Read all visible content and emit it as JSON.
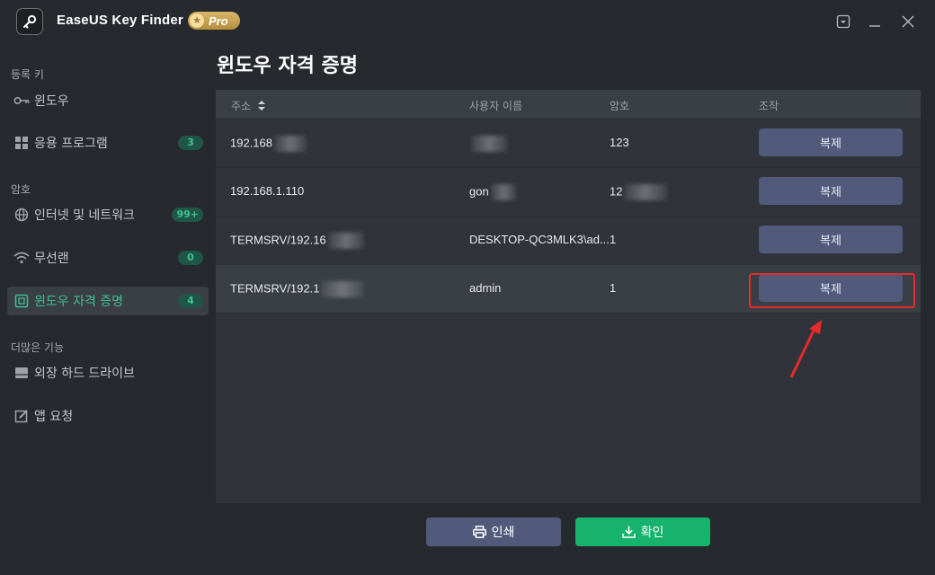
{
  "app": {
    "title": "EaseUS Key Finder",
    "pro_label": "Pro"
  },
  "sidebar": {
    "sections": [
      {
        "label": "등록 키"
      },
      {
        "label": "암호"
      },
      {
        "label": "더많은 기능"
      }
    ],
    "items": [
      {
        "label": "윈도우",
        "icon": "key-icon"
      },
      {
        "label": "응용 프로그램",
        "icon": "apps-grid-icon",
        "badge": "3"
      },
      {
        "label": "인터넷 및 네트워크",
        "icon": "globe-icon",
        "badge": "99+"
      },
      {
        "label": "무선랜",
        "icon": "wifi-icon",
        "badge": "0"
      },
      {
        "label": "윈도우 자격 증명",
        "icon": "credential-icon",
        "badge": "4",
        "active": true
      },
      {
        "label": "외장 하드 드라이브",
        "icon": "hard-drive-icon"
      },
      {
        "label": "앱 요청",
        "icon": "edit-icon"
      }
    ]
  },
  "main": {
    "title": "윈도우 자격 증명",
    "columns": [
      "주소",
      "사용자 이름",
      "암호",
      "조작"
    ],
    "rows": [
      {
        "address": "192.168",
        "username": "",
        "password": "123",
        "action": "복제"
      },
      {
        "address": "192.168.1.110",
        "username": "gon",
        "password": "12",
        "action": "복제"
      },
      {
        "address": "TERMSRV/192.16",
        "username": "DESKTOP-QC3MLK3\\ad...",
        "password": "1",
        "action": "복제"
      },
      {
        "address": "TERMSRV/192.1",
        "username": "admin",
        "password": "1",
        "action": "복제"
      }
    ]
  },
  "footer": {
    "print_label": "인쇄",
    "confirm_label": "확인"
  },
  "colors": {
    "accent_green": "#17b36d",
    "active_text": "#3ec28f",
    "button_blue": "#525a7c",
    "annotation_red": "#e52b2b"
  }
}
